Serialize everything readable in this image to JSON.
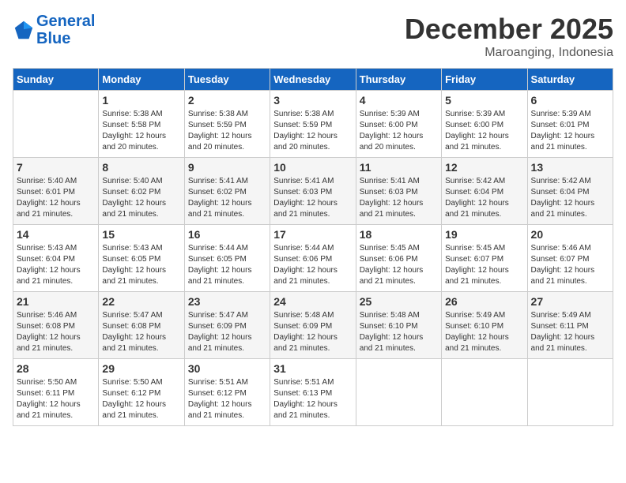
{
  "header": {
    "logo_line1": "General",
    "logo_line2": "Blue",
    "month_title": "December 2025",
    "location": "Maroanging, Indonesia"
  },
  "days_of_week": [
    "Sunday",
    "Monday",
    "Tuesday",
    "Wednesday",
    "Thursday",
    "Friday",
    "Saturday"
  ],
  "weeks": [
    [
      {
        "day": "",
        "info": ""
      },
      {
        "day": "1",
        "info": "Sunrise: 5:38 AM\nSunset: 5:58 PM\nDaylight: 12 hours\nand 20 minutes."
      },
      {
        "day": "2",
        "info": "Sunrise: 5:38 AM\nSunset: 5:59 PM\nDaylight: 12 hours\nand 20 minutes."
      },
      {
        "day": "3",
        "info": "Sunrise: 5:38 AM\nSunset: 5:59 PM\nDaylight: 12 hours\nand 20 minutes."
      },
      {
        "day": "4",
        "info": "Sunrise: 5:39 AM\nSunset: 6:00 PM\nDaylight: 12 hours\nand 20 minutes."
      },
      {
        "day": "5",
        "info": "Sunrise: 5:39 AM\nSunset: 6:00 PM\nDaylight: 12 hours\nand 21 minutes."
      },
      {
        "day": "6",
        "info": "Sunrise: 5:39 AM\nSunset: 6:01 PM\nDaylight: 12 hours\nand 21 minutes."
      }
    ],
    [
      {
        "day": "7",
        "info": "Sunrise: 5:40 AM\nSunset: 6:01 PM\nDaylight: 12 hours\nand 21 minutes."
      },
      {
        "day": "8",
        "info": "Sunrise: 5:40 AM\nSunset: 6:02 PM\nDaylight: 12 hours\nand 21 minutes."
      },
      {
        "day": "9",
        "info": "Sunrise: 5:41 AM\nSunset: 6:02 PM\nDaylight: 12 hours\nand 21 minutes."
      },
      {
        "day": "10",
        "info": "Sunrise: 5:41 AM\nSunset: 6:03 PM\nDaylight: 12 hours\nand 21 minutes."
      },
      {
        "day": "11",
        "info": "Sunrise: 5:41 AM\nSunset: 6:03 PM\nDaylight: 12 hours\nand 21 minutes."
      },
      {
        "day": "12",
        "info": "Sunrise: 5:42 AM\nSunset: 6:04 PM\nDaylight: 12 hours\nand 21 minutes."
      },
      {
        "day": "13",
        "info": "Sunrise: 5:42 AM\nSunset: 6:04 PM\nDaylight: 12 hours\nand 21 minutes."
      }
    ],
    [
      {
        "day": "14",
        "info": "Sunrise: 5:43 AM\nSunset: 6:04 PM\nDaylight: 12 hours\nand 21 minutes."
      },
      {
        "day": "15",
        "info": "Sunrise: 5:43 AM\nSunset: 6:05 PM\nDaylight: 12 hours\nand 21 minutes."
      },
      {
        "day": "16",
        "info": "Sunrise: 5:44 AM\nSunset: 6:05 PM\nDaylight: 12 hours\nand 21 minutes."
      },
      {
        "day": "17",
        "info": "Sunrise: 5:44 AM\nSunset: 6:06 PM\nDaylight: 12 hours\nand 21 minutes."
      },
      {
        "day": "18",
        "info": "Sunrise: 5:45 AM\nSunset: 6:06 PM\nDaylight: 12 hours\nand 21 minutes."
      },
      {
        "day": "19",
        "info": "Sunrise: 5:45 AM\nSunset: 6:07 PM\nDaylight: 12 hours\nand 21 minutes."
      },
      {
        "day": "20",
        "info": "Sunrise: 5:46 AM\nSunset: 6:07 PM\nDaylight: 12 hours\nand 21 minutes."
      }
    ],
    [
      {
        "day": "21",
        "info": "Sunrise: 5:46 AM\nSunset: 6:08 PM\nDaylight: 12 hours\nand 21 minutes."
      },
      {
        "day": "22",
        "info": "Sunrise: 5:47 AM\nSunset: 6:08 PM\nDaylight: 12 hours\nand 21 minutes."
      },
      {
        "day": "23",
        "info": "Sunrise: 5:47 AM\nSunset: 6:09 PM\nDaylight: 12 hours\nand 21 minutes."
      },
      {
        "day": "24",
        "info": "Sunrise: 5:48 AM\nSunset: 6:09 PM\nDaylight: 12 hours\nand 21 minutes."
      },
      {
        "day": "25",
        "info": "Sunrise: 5:48 AM\nSunset: 6:10 PM\nDaylight: 12 hours\nand 21 minutes."
      },
      {
        "day": "26",
        "info": "Sunrise: 5:49 AM\nSunset: 6:10 PM\nDaylight: 12 hours\nand 21 minutes."
      },
      {
        "day": "27",
        "info": "Sunrise: 5:49 AM\nSunset: 6:11 PM\nDaylight: 12 hours\nand 21 minutes."
      }
    ],
    [
      {
        "day": "28",
        "info": "Sunrise: 5:50 AM\nSunset: 6:11 PM\nDaylight: 12 hours\nand 21 minutes."
      },
      {
        "day": "29",
        "info": "Sunrise: 5:50 AM\nSunset: 6:12 PM\nDaylight: 12 hours\nand 21 minutes."
      },
      {
        "day": "30",
        "info": "Sunrise: 5:51 AM\nSunset: 6:12 PM\nDaylight: 12 hours\nand 21 minutes."
      },
      {
        "day": "31",
        "info": "Sunrise: 5:51 AM\nSunset: 6:13 PM\nDaylight: 12 hours\nand 21 minutes."
      },
      {
        "day": "",
        "info": ""
      },
      {
        "day": "",
        "info": ""
      },
      {
        "day": "",
        "info": ""
      }
    ]
  ]
}
